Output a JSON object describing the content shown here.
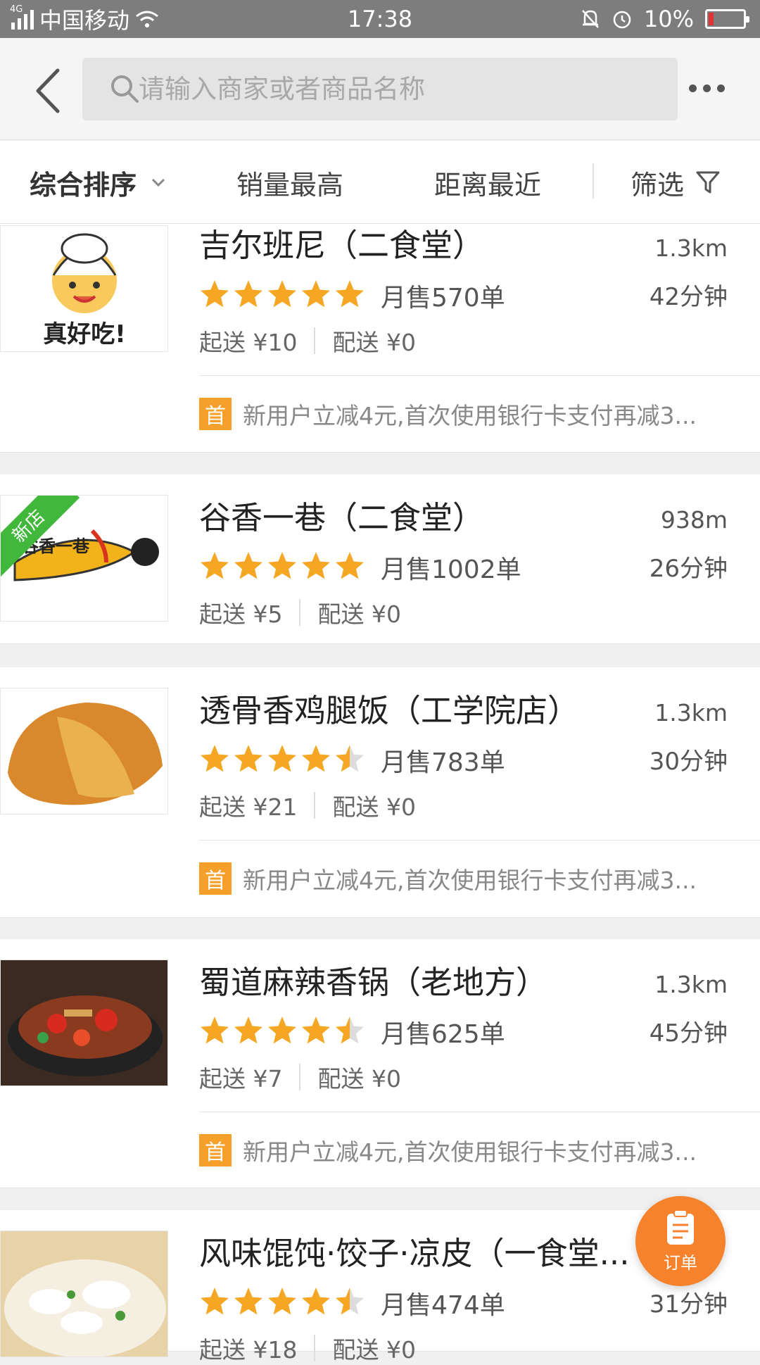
{
  "status_bar": {
    "network": "4G",
    "carrier": "中国移动",
    "time": "17:38",
    "battery": "10%"
  },
  "header": {
    "search_placeholder": "请输入商家或者商品名称"
  },
  "sort_bar": {
    "items": [
      "综合排序",
      "销量最高",
      "距离最近",
      "筛选"
    ]
  },
  "shops": [
    {
      "name": "吉尔班尼（二食堂）",
      "distance": "1.3km",
      "time": "42分钟",
      "rating": 5,
      "sales": "月售570单",
      "min_order": "起送 ¥10",
      "delivery": "配送 ¥0",
      "promo_badge": "首",
      "promo": "新用户立减4元,首次使用银行卡支付再减3...",
      "image": "chef-logo"
    },
    {
      "name": "谷香一巷（二食堂）",
      "distance": "938m",
      "time": "26分钟",
      "rating": 5,
      "sales": "月售1002单",
      "min_order": "起送 ¥5",
      "delivery": "配送 ¥0",
      "new_tag": "新店",
      "image": "guxiang-logo"
    },
    {
      "name": "透骨香鸡腿饭（工学院店）",
      "distance": "1.3km",
      "time": "30分钟",
      "rating": 4.5,
      "sales": "月售783单",
      "min_order": "起送 ¥21",
      "delivery": "配送 ¥0",
      "promo_badge": "首",
      "promo": "新用户立减4元,首次使用银行卡支付再减3...",
      "image": "fried-chicken"
    },
    {
      "name": "蜀道麻辣香锅（老地方）",
      "distance": "1.3km",
      "time": "45分钟",
      "rating": 4.5,
      "sales": "月售625单",
      "min_order": "起送 ¥7",
      "delivery": "配送 ¥0",
      "promo_badge": "首",
      "promo": "新用户立减4元,首次使用银行卡支付再减3...",
      "image": "spicy-pot"
    },
    {
      "name": "风味馄饨·饺子·凉皮（一食堂...",
      "time": "31分钟",
      "rating": 4.5,
      "sales": "月售474单",
      "min_order": "起送 ¥18",
      "delivery": "配送 ¥0",
      "image": "dumplings"
    }
  ],
  "order_button": {
    "label": "订单"
  },
  "colors": {
    "accent": "#f7822c",
    "star": "#f5a623",
    "badge": "#f5a02a",
    "new_tag": "#41b83c"
  }
}
